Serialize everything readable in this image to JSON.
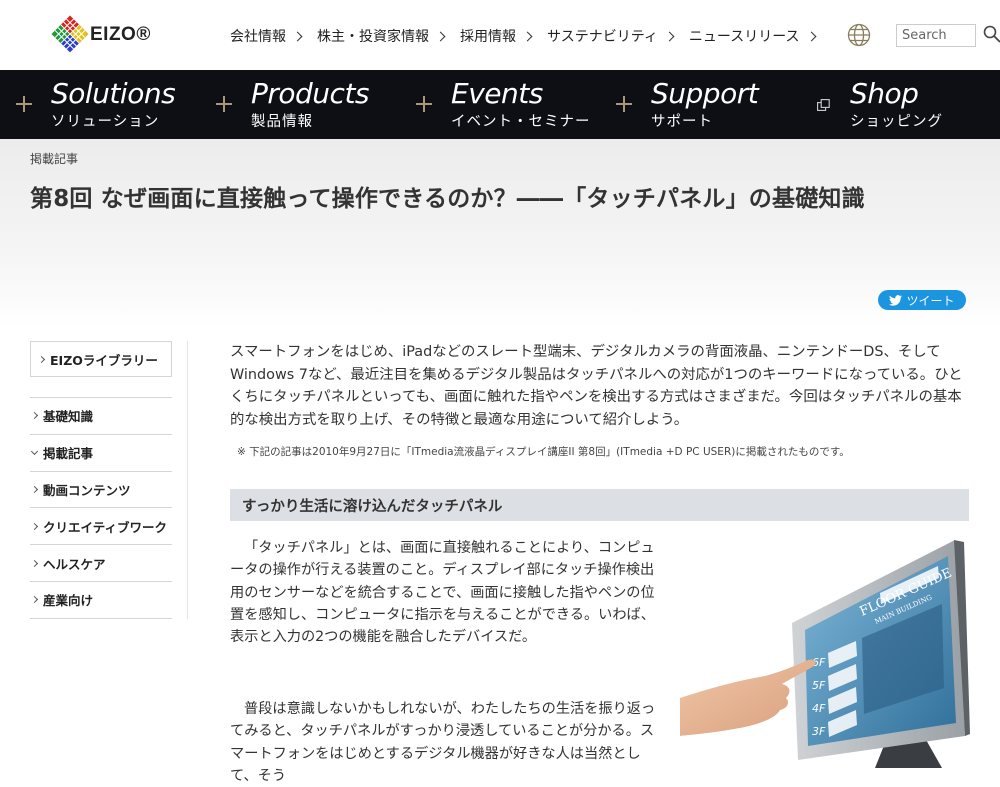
{
  "brand": {
    "logo_text": "EIZO®"
  },
  "topnav": [
    {
      "label": "会社情報"
    },
    {
      "label": "株主・投資家情報"
    },
    {
      "label": "採用情報"
    },
    {
      "label": "サステナビリティ"
    },
    {
      "label": "ニュースリリース"
    }
  ],
  "search": {
    "placeholder": "Search"
  },
  "mainnav": [
    {
      "en": "Solutions",
      "ja": "ソリューション",
      "icon": "plus-icon"
    },
    {
      "en": "Products",
      "ja": "製品情報",
      "icon": "plus-icon"
    },
    {
      "en": "Events",
      "ja": "イベント・セミナー",
      "icon": "plus-icon"
    },
    {
      "en": "Support",
      "ja": "サポート",
      "icon": "plus-icon"
    },
    {
      "en": "Shop",
      "ja": "ショッピング",
      "icon": "external-window-icon"
    }
  ],
  "article": {
    "category": "掲載記事",
    "title": "第8回 なぜ画面に直接触って操作できるのか？――「タッチパネル」の基礎知識",
    "tweet_label": "ツイート",
    "intro": "スマートフォンをはじめ、iPadなどのスレート型端末、デジタルカメラの背面液晶、ニンテンドーDS、そしてWindows 7など、最近注目を集めるデジタル製品はタッチパネルへの対応が1つのキーワードになっている。ひとくちにタッチパネルといっても、画面に触れた指やペンを検出する方式はさまざまだ。今回はタッチパネルの基本的な検出方式を取り上げ、その特徴と最適な用途について紹介しよう。",
    "note": "※ 下記の記事は2010年9月27日に「ITmedia流液晶ディスプレイ講座II 第8回」(ITmedia +D PC USER)に掲載されたものです。",
    "section_heading": "すっかり生活に溶け込んだタッチパネル",
    "para1": "「タッチパネル」とは、画面に直接触れることにより、コンピュータの操作が行える装置のこと。ディスプレイ部にタッチ操作検出用のセンサーなどを統合することで、画面に接触した指やペンの位置を感知し、コンピュータに指示を与えることができる。いわば、表示と入力の2つの機能を融合したデバイスだ。",
    "para2": "普段は意識しないかもしれないが、わたしたちの生活を振り返ってみると、タッチパネルがすっかり浸透していることが分かる。スマートフォンをはじめとするデジタル機器が好きな人は当然として、そう"
  },
  "sidebar": {
    "head": "EIZOライブラリー",
    "items": [
      {
        "label": "基礎知識",
        "expanded": false
      },
      {
        "label": "掲載記事",
        "expanded": true
      },
      {
        "label": "動画コンテンツ",
        "expanded": false
      },
      {
        "label": "クリエイティブワーク",
        "expanded": false
      },
      {
        "label": "ヘルスケア",
        "expanded": false
      },
      {
        "label": "産業向け",
        "expanded": false
      }
    ]
  },
  "figure": {
    "screen_title": "FLOOR GUIDE",
    "screen_subtitle": "MAIN BUILDING",
    "floors": [
      "6F",
      "5F",
      "4F",
      "3F"
    ]
  },
  "colors": {
    "nav_bg": "#0e0f14",
    "nav_accent": "#a89a74",
    "tweet_blue": "#1b95e0",
    "heading_bg": "#dcdfe3"
  }
}
